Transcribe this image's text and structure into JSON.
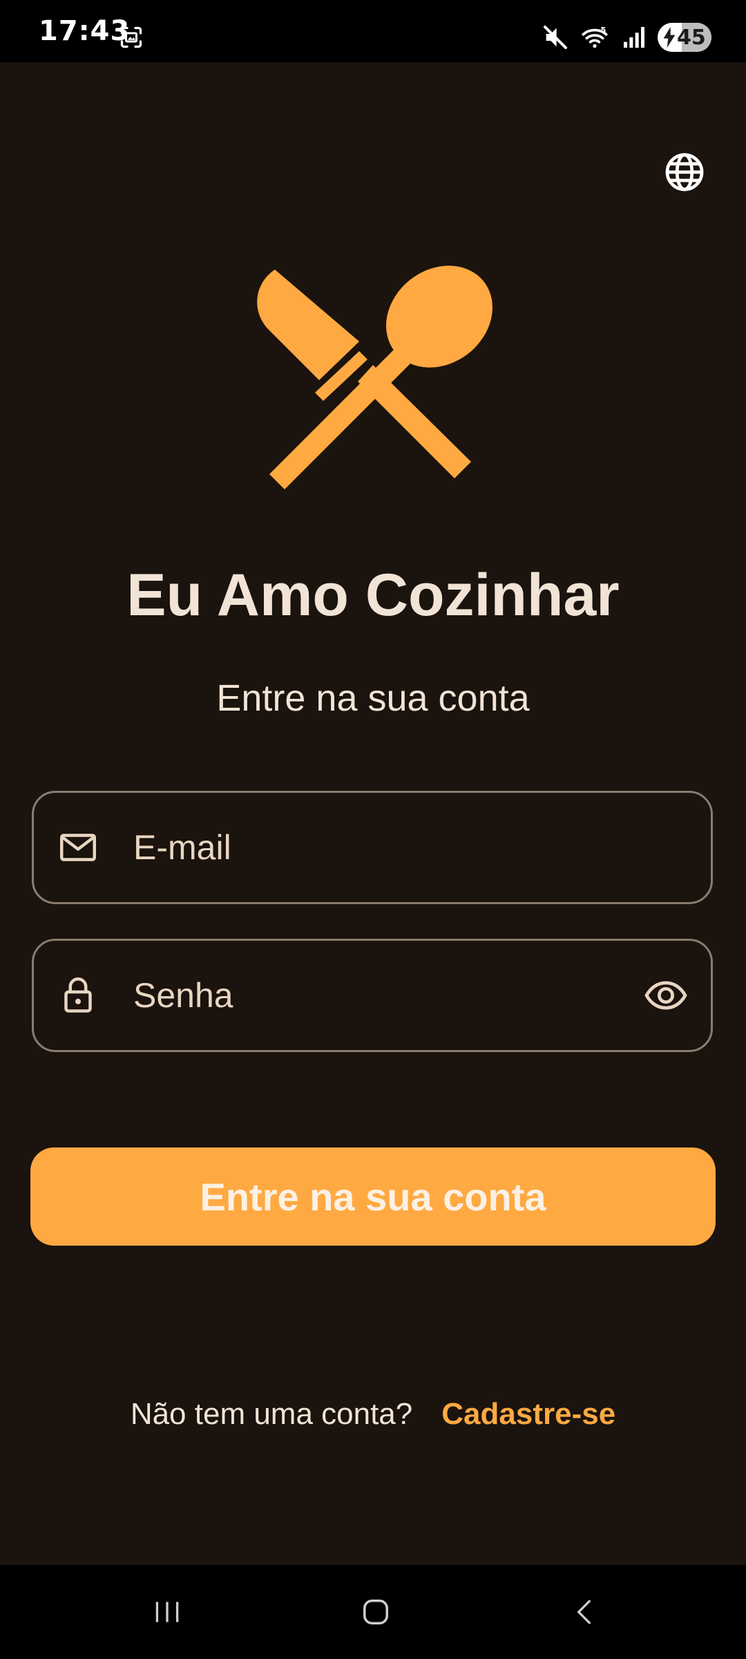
{
  "status_bar": {
    "time": "17:43",
    "battery_level": "45",
    "icons": [
      "screenshot-icon",
      "mute-icon",
      "wifi-icon",
      "signal-icon",
      "battery-icon"
    ]
  },
  "language_icon": "globe-icon",
  "app": {
    "title": "Eu Amo Cozinhar",
    "subtitle": "Entre na sua conta",
    "logo_icon": "knife-spoon-crossed-icon"
  },
  "form": {
    "email": {
      "placeholder": "E-mail",
      "value": "",
      "icon": "mail-icon"
    },
    "password": {
      "placeholder": "Senha",
      "value": "",
      "icon": "lock-icon",
      "toggle_icon": "eye-icon"
    },
    "submit_label": "Entre na sua conta"
  },
  "signup": {
    "prompt": "Não tem uma conta?",
    "link_label": "Cadastre-se"
  },
  "nav_bar": {
    "icons": [
      "recents-icon",
      "home-icon",
      "back-icon"
    ]
  },
  "colors": {
    "background": "#1b130d",
    "accent": "#ffa942",
    "text": "#f1e4d6",
    "field_border": "#8a7c6e"
  }
}
